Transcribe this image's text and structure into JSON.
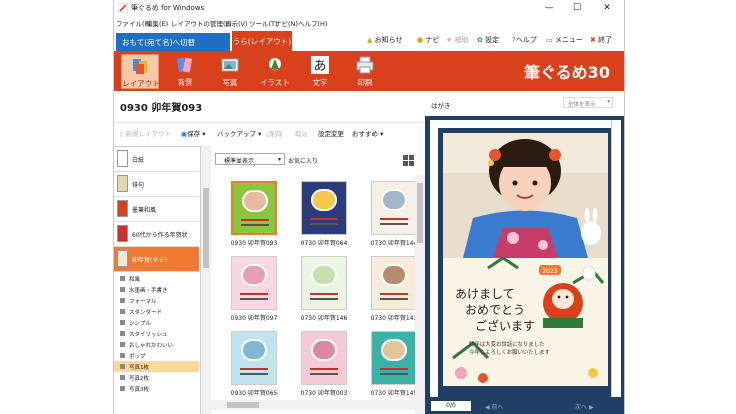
{
  "window": {
    "title": "筆ぐるめ for Windows",
    "controls": [
      "—",
      "☐",
      "✕"
    ]
  },
  "menu": [
    "ファイル(F)",
    "編集(E)",
    "レイアウトの管理(L)",
    "表示(V)",
    "ツール(T)",
    "ナビ(N)",
    "ヘルプ(H)"
  ],
  "tabs": {
    "omote": "おもて(宛て名)へ切替",
    "ura": "うら(レイアウト)"
  },
  "top_links": {
    "news": "お知らせ",
    "navi": "ナビ",
    "assist": "補助",
    "settings": "設定",
    "help": "ヘルプ",
    "menu": "メニュー",
    "exit": "終了"
  },
  "ribbon": {
    "layout": "レイアウト",
    "background": "背景",
    "photo": "写真",
    "illust": "イラスト",
    "text": "文字",
    "print": "印刷",
    "brand": "筆ぐるめ30",
    "text_icon_glyph": "あ"
  },
  "document": {
    "title": "0930 卯年賀093"
  },
  "toolbar": {
    "new_layout": "新規レイアウト",
    "save": "保存",
    "backup": "バックアップ",
    "delete": "削除",
    "import": "取込",
    "change_settings": "設定変更",
    "recommended": "おすすめ"
  },
  "sidebar": {
    "categories": [
      {
        "label": "白紙"
      },
      {
        "label": "俳句"
      },
      {
        "label": "墨筆和風"
      },
      {
        "label": "60代から作る年賀状"
      },
      {
        "label": "卯年賀(タテ)"
      }
    ],
    "subitems": [
      "和風",
      "水墨画・手書き",
      "フォーマル",
      "スタンダード",
      "シンプル",
      "スタイリッシュ",
      "おしゃれかわいい",
      "ポップ",
      "写真1枚",
      "写真2枚",
      "写真3枚"
    ]
  },
  "grid": {
    "view_select": "標準並表示",
    "favorites": "お気に入り",
    "items": [
      {
        "label": "0930 卯年賀093",
        "bg": "#8cc63e",
        "photo": "#e9b9a0"
      },
      {
        "label": "0730 卯年賀064",
        "bg": "#2a3d7a",
        "photo": "#f2c94c"
      },
      {
        "label": "0730 卯年賀144",
        "bg": "#f6f0e6",
        "photo": "#a3b9c9"
      },
      {
        "label": "0930 卯年賀097",
        "bg": "#f7d7e2",
        "photo": "#e5a0b8"
      },
      {
        "label": "0730 卯年賀146",
        "bg": "#e9f5e2",
        "photo": "#c8dfb0"
      },
      {
        "label": "0730 卯年賀143",
        "bg": "#f6ecd9",
        "photo": "#b88c6a"
      },
      {
        "label": "0930 卯年賀065",
        "bg": "#bfe4ef",
        "photo": "#7fb8d0"
      },
      {
        "label": "0730 卯年賀003",
        "bg": "#f5c9d6",
        "photo": "#d98aa0"
      },
      {
        "label": "0730 卯年賀145",
        "bg": "#39b3a7",
        "photo": "#e2c69a"
      }
    ]
  },
  "preview": {
    "label": "はがき",
    "zoom": "全体を表示",
    "page": "0/0",
    "prev": "前へ",
    "next": "次へ",
    "greeting_line1": "あけまして",
    "greeting_line2": "おめでとう",
    "greeting_line3": "ございます",
    "message_line1": "昨年は大変お世話になりました",
    "message_line2": "今年もよろしくお願いいたします",
    "year_badge": "2023"
  },
  "colors": {
    "accent": "#d9401c",
    "blue_tab": "#1f6fc5",
    "selected_category": "#f07a30",
    "preview_bg": "#203f66"
  }
}
